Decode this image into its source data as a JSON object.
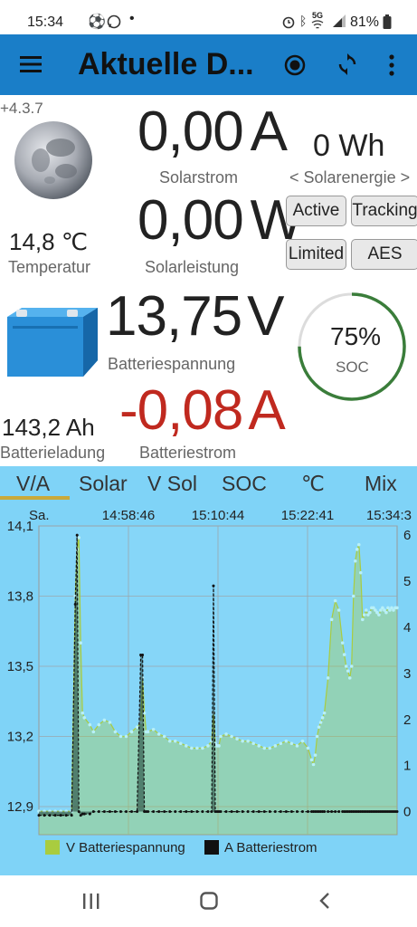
{
  "status_bar": {
    "time": "15:34",
    "network": "5G",
    "battery_pct": "81%"
  },
  "app_bar": {
    "title": "Aktuelle D..."
  },
  "version": "+4.3.7",
  "solar_current": {
    "value": "0,00",
    "unit": "A",
    "label": "Solarstrom"
  },
  "solar_energy": {
    "value": "0 Wh",
    "label": "< Solarenergie >"
  },
  "solar_power": {
    "value": "0,00",
    "unit": "W",
    "label": "Solarleistung"
  },
  "temperature": {
    "value": "14,8 ℃",
    "label": "Temperatur"
  },
  "chips": [
    "Active",
    "Tracking",
    "Limited",
    "AES"
  ],
  "battery_voltage": {
    "value": "13,75",
    "unit": "V",
    "label": "Batteriespannung"
  },
  "soc": {
    "value": "75%",
    "label": "SOC",
    "fraction": 0.75
  },
  "battery_charge": {
    "value": "143,2 Ah",
    "label": "Batterieladung"
  },
  "battery_current": {
    "value": "-0,08",
    "unit": "A",
    "label": "Batteriestrom"
  },
  "tabs": [
    "V/A",
    "Solar",
    "V Sol",
    "SOC",
    "℃",
    "Mix"
  ],
  "active_tab": "V/A",
  "colors": {
    "app_bar": "#1a7ec8",
    "chart_bg": "#7fd3f7",
    "voltage_series": "#a9cc3f",
    "current_series": "#111111",
    "negative": "#c0291f",
    "soc_ring": "#3a7d3a"
  },
  "chart_data": {
    "type": "area",
    "x_tick_labels": [
      "Sa.",
      "14:58:46",
      "15:10:44",
      "15:22:41",
      "15:34:3"
    ],
    "x": [
      0,
      6,
      12,
      18,
      24,
      30,
      36,
      40,
      42,
      44,
      46,
      48,
      50,
      56,
      60,
      66,
      72,
      78,
      84,
      90,
      96,
      102,
      108,
      112,
      114,
      116,
      118,
      120,
      126,
      132,
      138,
      144,
      150,
      156,
      162,
      168,
      174,
      180,
      186,
      190,
      192,
      194,
      196,
      198,
      200,
      206,
      212,
      218,
      224,
      230,
      236,
      242,
      248,
      254,
      260,
      266,
      272,
      278,
      284,
      290,
      296,
      300,
      302,
      304,
      306,
      308,
      310,
      312,
      314,
      318,
      322,
      326,
      330,
      334,
      336,
      338,
      340,
      342,
      344,
      346,
      348,
      350,
      352,
      354,
      356,
      358,
      360,
      362,
      364,
      366,
      368,
      370,
      372,
      374,
      376,
      378,
      380,
      382,
      384,
      386,
      388,
      390,
      392,
      394
    ],
    "y_left_ticks": [
      "14,1",
      "13,8",
      "13,5",
      "13,2",
      "12,9"
    ],
    "y_left_range": [
      12.78,
      14.1
    ],
    "y_right_ticks": [
      "6",
      "5",
      "4",
      "3",
      "2",
      "1",
      "0"
    ],
    "y_right_range": [
      -0.5,
      6.2
    ],
    "series": [
      {
        "name": "V Batteriespannung",
        "axis": "left",
        "values": [
          12.88,
          12.88,
          12.88,
          12.88,
          12.88,
          12.88,
          12.88,
          13.8,
          14.0,
          14.05,
          13.6,
          13.3,
          13.28,
          13.25,
          13.22,
          13.25,
          13.27,
          13.26,
          13.22,
          13.2,
          13.2,
          13.22,
          13.24,
          13.26,
          13.45,
          13.3,
          13.22,
          13.22,
          13.23,
          13.21,
          13.2,
          13.18,
          13.18,
          13.17,
          13.16,
          13.15,
          13.15,
          13.15,
          13.16,
          13.18,
          13.3,
          13.17,
          13.16,
          13.16,
          13.2,
          13.21,
          13.2,
          13.19,
          13.18,
          13.18,
          13.17,
          13.16,
          13.15,
          13.15,
          13.16,
          13.17,
          13.18,
          13.17,
          13.16,
          13.18,
          13.15,
          13.1,
          13.08,
          13.12,
          13.2,
          13.24,
          13.26,
          13.28,
          13.3,
          13.45,
          13.7,
          13.78,
          13.74,
          13.6,
          13.55,
          13.5,
          13.48,
          13.45,
          13.5,
          13.8,
          13.95,
          14.0,
          14.02,
          13.9,
          13.7,
          13.72,
          13.74,
          13.72,
          13.73,
          13.75,
          13.75,
          13.74,
          13.73,
          13.72,
          13.74,
          13.75,
          13.74,
          13.73,
          13.75,
          13.74,
          13.75,
          13.74,
          13.75,
          13.75
        ]
      },
      {
        "name": "A Batteriestrom",
        "axis": "right",
        "values": [
          -0.08,
          -0.08,
          -0.08,
          -0.08,
          -0.08,
          -0.08,
          -0.08,
          4.5,
          6.0,
          0.0,
          -0.08,
          -0.05,
          -0.05,
          -0.05,
          0.0,
          0.0,
          0.0,
          0.0,
          0.0,
          0.0,
          0.0,
          0.0,
          0.0,
          3.4,
          3.4,
          0.0,
          0.0,
          0.0,
          0.0,
          0.0,
          0.0,
          0.0,
          0.0,
          0.0,
          0.0,
          0.0,
          0.0,
          0.0,
          0.0,
          0.0,
          4.9,
          0.0,
          0.0,
          0.0,
          0.0,
          0.0,
          0.0,
          0.0,
          0.0,
          0.0,
          0.0,
          0.0,
          0.0,
          0.0,
          0.0,
          0.0,
          0.0,
          0.0,
          0.0,
          0.0,
          0.0,
          0.0,
          0.0,
          0.0,
          0.0,
          0.0,
          0.0,
          0.0,
          0.0,
          0.0,
          0.0,
          0.0,
          0.0,
          0.0,
          0.0,
          0.0,
          0.0,
          0.0,
          0.0,
          0.0,
          0.0,
          0.0,
          0.0,
          0.0,
          0.0,
          0.0,
          0.0,
          0.0,
          0.0,
          0.0,
          0.0,
          0.0,
          0.0,
          0.0,
          0.0,
          0.0,
          0.0,
          0.0,
          0.0,
          0.0,
          0.0,
          0.0,
          0.0,
          0.0
        ]
      }
    ],
    "legend_position": "bottom",
    "grid": true
  },
  "nav_bar": {
    "recents": "recents",
    "home": "home",
    "back": "back"
  }
}
